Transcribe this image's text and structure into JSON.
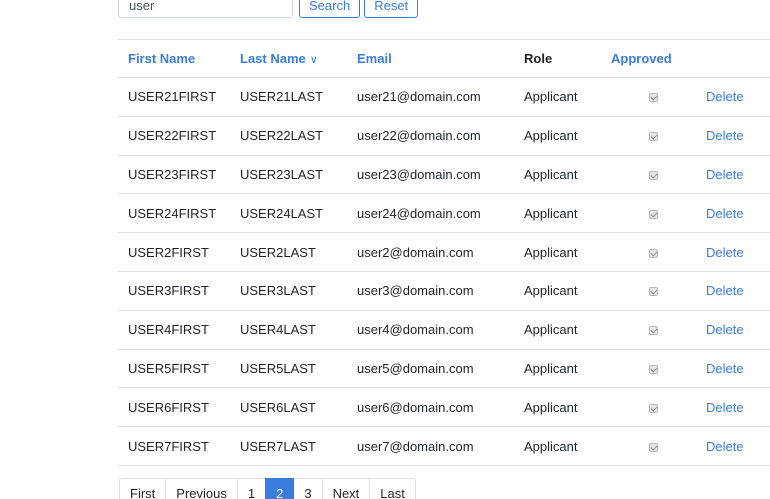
{
  "search": {
    "value": "user",
    "search_label": "Search",
    "reset_label": "Reset"
  },
  "table": {
    "headers": {
      "first_name": "First Name",
      "last_name": "Last Name",
      "last_name_sort": "∨",
      "email": "Email",
      "role": "Role",
      "approved": "Approved"
    },
    "delete_label": "Delete",
    "rows": [
      {
        "first": "USER21FIRST",
        "last": "USER21LAST",
        "email": "user21@domain.com",
        "role": "Applicant",
        "approved": true
      },
      {
        "first": "USER22FIRST",
        "last": "USER22LAST",
        "email": "user22@domain.com",
        "role": "Applicant",
        "approved": true
      },
      {
        "first": "USER23FIRST",
        "last": "USER23LAST",
        "email": "user23@domain.com",
        "role": "Applicant",
        "approved": true
      },
      {
        "first": "USER24FIRST",
        "last": "USER24LAST",
        "email": "user24@domain.com",
        "role": "Applicant",
        "approved": true
      },
      {
        "first": "USER2FIRST",
        "last": "USER2LAST",
        "email": "user2@domain.com",
        "role": "Applicant",
        "approved": true
      },
      {
        "first": "USER3FIRST",
        "last": "USER3LAST",
        "email": "user3@domain.com",
        "role": "Applicant",
        "approved": true
      },
      {
        "first": "USER4FIRST",
        "last": "USER4LAST",
        "email": "user4@domain.com",
        "role": "Applicant",
        "approved": true
      },
      {
        "first": "USER5FIRST",
        "last": "USER5LAST",
        "email": "user5@domain.com",
        "role": "Applicant",
        "approved": true
      },
      {
        "first": "USER6FIRST",
        "last": "USER6LAST",
        "email": "user6@domain.com",
        "role": "Applicant",
        "approved": true
      },
      {
        "first": "USER7FIRST",
        "last": "USER7LAST",
        "email": "user7@domain.com",
        "role": "Applicant",
        "approved": true
      }
    ]
  },
  "pagination": {
    "first": "First",
    "previous": "Previous",
    "pages": [
      "1",
      "2",
      "3"
    ],
    "current": "2",
    "next": "Next",
    "last": "Last"
  },
  "colors": {
    "accent": "#3b7ddd",
    "border": "#dee2e6"
  }
}
